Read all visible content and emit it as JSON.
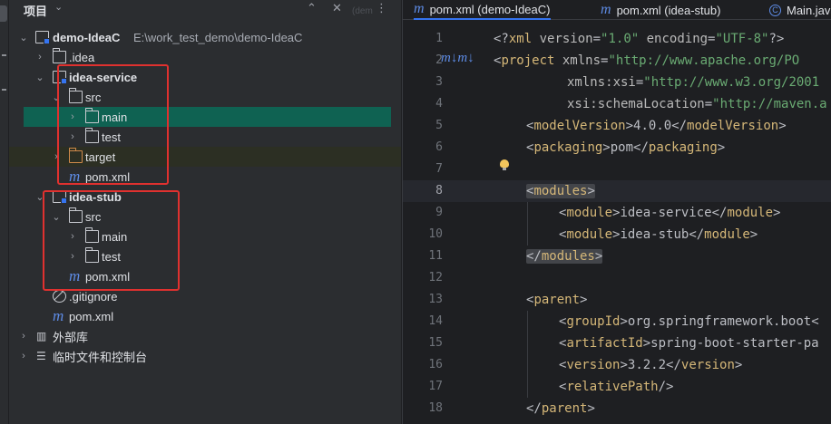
{
  "project_panel": {
    "title": "项目",
    "title_chevron": "⌄",
    "header_icons": {
      "expand": "⌃",
      "collapse": "⌄",
      "close": "✕",
      "more": "⋮"
    },
    "ghost_text": "(dem",
    "tree": [
      {
        "label": "demo-IdeaC",
        "path": "E:\\work_test_demo\\demo-IdeaC",
        "icon": "module-folder-icon",
        "expanded": true
      },
      {
        "label": ".idea",
        "icon": "folder-icon",
        "expanded": false
      },
      {
        "label": "idea-service",
        "icon": "module-folder-icon",
        "expanded": true
      },
      {
        "label": "src",
        "icon": "folder-icon",
        "expanded": true
      },
      {
        "label": "main",
        "icon": "folder-icon",
        "expanded": false,
        "selected": true
      },
      {
        "label": "test",
        "icon": "folder-icon",
        "expanded": false
      },
      {
        "label": "target",
        "icon": "excluded-folder-icon",
        "expanded": false
      },
      {
        "label": "pom.xml",
        "icon": "maven-icon"
      },
      {
        "label": "idea-stub",
        "icon": "module-folder-icon",
        "expanded": true
      },
      {
        "label": "src",
        "icon": "folder-icon",
        "expanded": true
      },
      {
        "label": "main",
        "icon": "folder-icon",
        "expanded": false
      },
      {
        "label": "test",
        "icon": "folder-icon",
        "expanded": false
      },
      {
        "label": "pom.xml",
        "icon": "maven-icon"
      },
      {
        "label": ".gitignore",
        "icon": "ignore-file-icon"
      },
      {
        "label": "pom.xml",
        "icon": "maven-icon"
      },
      {
        "label": "外部库",
        "icon": "library-icon",
        "expanded": false
      },
      {
        "label": "临时文件和控制台",
        "icon": "scratches-icon",
        "expanded": false
      }
    ]
  },
  "editor": {
    "tabs": [
      {
        "label": "pom.xml (demo-IdeaC)",
        "icon": "maven-icon",
        "active": true
      },
      {
        "label": "pom.xml (idea-stub)",
        "icon": "maven-icon",
        "active": false
      },
      {
        "label": "Main.java",
        "icon": "class-icon",
        "active": false
      }
    ],
    "current_line": 8,
    "lines": [
      {
        "n": "1"
      },
      {
        "n": "2"
      },
      {
        "n": "3"
      },
      {
        "n": "4"
      },
      {
        "n": "5"
      },
      {
        "n": "6"
      },
      {
        "n": "7"
      },
      {
        "n": "8"
      },
      {
        "n": "9"
      },
      {
        "n": "10"
      },
      {
        "n": "11"
      },
      {
        "n": "12"
      },
      {
        "n": "13"
      },
      {
        "n": "14"
      },
      {
        "n": "15"
      },
      {
        "n": "16"
      },
      {
        "n": "17"
      },
      {
        "n": "18"
      }
    ],
    "code": {
      "l1": {
        "a": "<?",
        "b": "xml",
        "c": " version",
        "d": "=",
        "e": "\"1.0\"",
        "f": " encoding",
        "g": "=",
        "h": "\"UTF-8\"",
        "i": "?>"
      },
      "l2": {
        "a": "<",
        "b": "project",
        "c": " xmlns",
        "d": "=",
        "e": "\"http://www.apache.org/PO"
      },
      "l3": {
        "a": "xmlns:xsi",
        "b": "=",
        "c": "\"http://www.w3.org/2001"
      },
      "l4": {
        "a": "xsi:schemaLocation",
        "b": "=",
        "c": "\"http://maven.a"
      },
      "l5": {
        "a": "<",
        "b": "modelVersion",
        "c": ">",
        "d": "4.0.0",
        "e": "</",
        "f": "modelVersion",
        "g": ">"
      },
      "l6": {
        "a": "<",
        "b": "packaging",
        "c": ">",
        "d": "pom",
        "e": "</",
        "f": "packaging",
        "g": ">"
      },
      "l8": {
        "a": "<",
        "b": "modules",
        "c": ">"
      },
      "l9": {
        "a": "<",
        "b": "module",
        "c": ">",
        "d": "idea-service",
        "e": "</",
        "f": "module",
        "g": ">"
      },
      "l10": {
        "a": "<",
        "b": "module",
        "c": ">",
        "d": "idea-stub",
        "e": "</",
        "f": "module",
        "g": ">"
      },
      "l11": {
        "a": "</",
        "b": "modules",
        "c": ">"
      },
      "l13": {
        "a": "<",
        "b": "parent",
        "c": ">"
      },
      "l14": {
        "a": "<",
        "b": "groupId",
        "c": ">",
        "d": "org.springframework.boot",
        "e": "<"
      },
      "l15": {
        "a": "<",
        "b": "artifactId",
        "c": ">",
        "d": "spring-boot-starter-pa"
      },
      "l16": {
        "a": "<",
        "b": "version",
        "c": ">",
        "d": "3.2.2",
        "e": "</",
        "f": "version",
        "g": ">"
      },
      "l17": {
        "a": "<",
        "b": "relativePath",
        "c": "/>"
      },
      "l18": {
        "a": "</",
        "b": "parent",
        "c": ">"
      }
    },
    "maven_gutter": "m↓m↓"
  },
  "colors": {
    "selection": "#0f6252",
    "highlight_box": "#e0312f",
    "tag": "#d5b778",
    "string": "#6aab73",
    "accent": "#3574f0"
  }
}
